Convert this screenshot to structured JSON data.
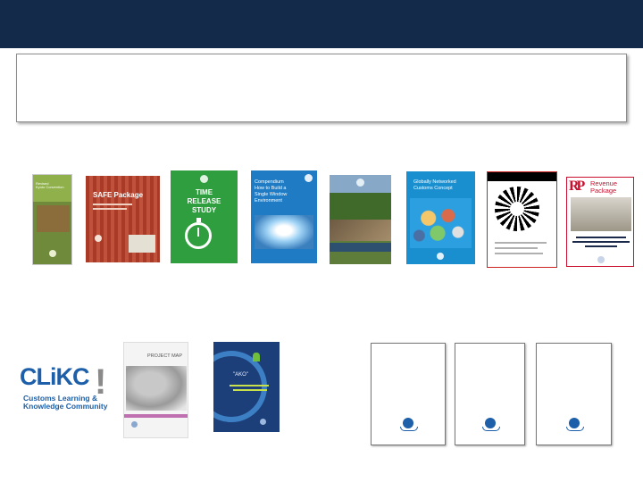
{
  "colors": {
    "header_bar": "#132a4a",
    "wco_blue": "#1d5fa8",
    "time_release_green": "#2f9e3f",
    "single_window_blue": "#1f7cc4",
    "safe_red": "#b5432e",
    "revenue_red": "#c8102e"
  },
  "covers": {
    "transit": {
      "title_line1": "Revised",
      "title_line2": "Kyoto Convention"
    },
    "safe": {
      "title": "SAFE Package"
    },
    "time_release": {
      "line1": "TIME",
      "line2": "RELEASE",
      "line3": "STUDY"
    },
    "single_window": {
      "line1": "Compendium",
      "line2": "How to Build a",
      "line3": "Single Window",
      "line4": "Environment"
    },
    "globally": {
      "line1": "Globally Networked",
      "line2": "Customs Concept"
    },
    "revenue": {
      "line1": "Revenue",
      "line2": "Package"
    },
    "clikc": {
      "logo": "CLiKC",
      "bang": "!",
      "line1": "Customs Learning &",
      "line2": "Knowledge Community"
    },
    "project_map": {
      "title": "PROJECT MAP"
    },
    "ako": {
      "title": "\"AKO\""
    }
  }
}
